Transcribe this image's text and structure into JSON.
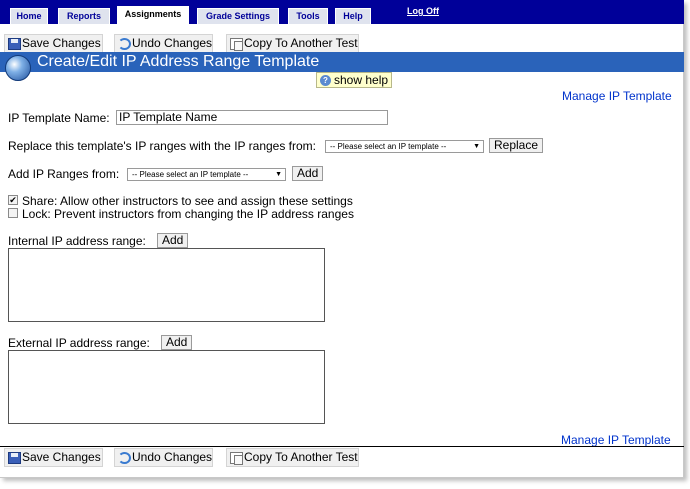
{
  "nav": {
    "tabs": [
      {
        "label": "Home"
      },
      {
        "label": "Reports"
      },
      {
        "label": "Assignments"
      },
      {
        "label": "Grade Settings"
      },
      {
        "label": "Tools"
      },
      {
        "label": "Help"
      }
    ],
    "active_tab": "Assignments",
    "logoff": "Log Off",
    "bar_color": "#000099"
  },
  "toolbar": {
    "save": "Save Changes",
    "undo": "Undo Changes",
    "copy": "Copy To Another Test"
  },
  "header": {
    "title": "Create/Edit IP Address Range Template",
    "show_help": "show help",
    "bar_color": "#2a63ba"
  },
  "links": {
    "manage_top": "Manage IP Template",
    "manage_bottom": "Manage IP Template"
  },
  "form": {
    "template_name_label": "IP Template Name:",
    "template_name_value": "IP Template Name",
    "replace_label": "Replace this template's IP ranges with the IP ranges from:",
    "replace_select": "-- Please select an IP template --",
    "replace_button": "Replace",
    "add_label": "Add IP Ranges from:",
    "add_select": "-- Please select an IP template --",
    "add_button": "Add",
    "share_label": "Share: Allow other instructors to see and assign these settings",
    "share_checked": true,
    "lock_label": "Lock: Prevent instructors from changing the IP address ranges",
    "lock_checked": false,
    "internal_label": "Internal IP address range:",
    "internal_add": "Add",
    "internal_value": "",
    "external_label": "External IP address range:",
    "external_add": "Add",
    "external_value": ""
  }
}
